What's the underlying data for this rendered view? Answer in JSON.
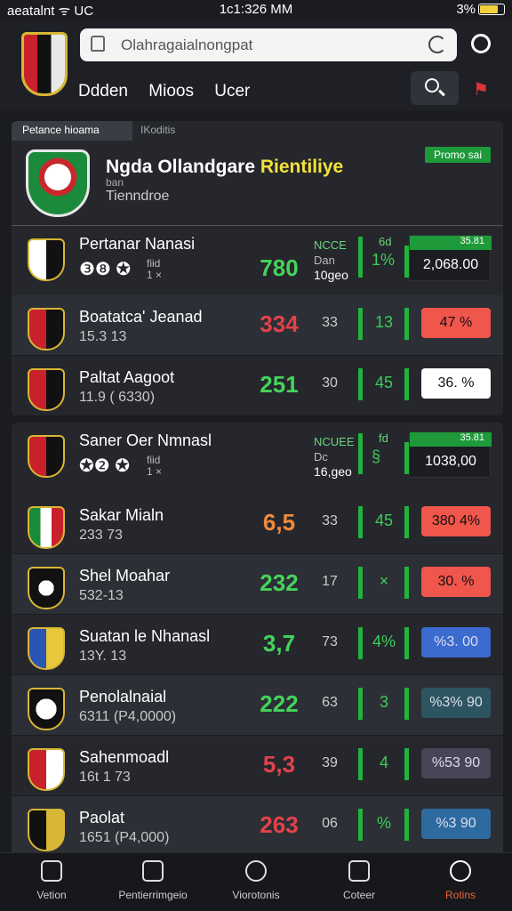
{
  "status": {
    "left": "aeatalnt ᯤ UC",
    "time": "1c1:326 MM",
    "right": "3%"
  },
  "search": {
    "placeholder": "Olahragaialnongpat"
  },
  "nav": {
    "items": [
      "Ddden",
      "Mioos",
      "Ucer"
    ]
  },
  "panel1": {
    "tabs": [
      "Petance hioama",
      "IKoditis"
    ],
    "league": {
      "name": "Ngda Ollandgare ",
      "highlight": "Rientiliye",
      "small": "ban",
      "sub": "Tienndroe",
      "promo": "Promo sai"
    },
    "top": {
      "team": "Pertanar Nanasi",
      "icons": "❸❽ ✪",
      "note": "fiid\n1 ×",
      "big": "780",
      "colhead": "NCCE",
      "colsub": "Dan",
      "colval": "10geo",
      "small": "1%",
      "smallh": "6d",
      "box_head": "35.81",
      "box_value": "2,068.00"
    },
    "rows": [
      {
        "team": "Boatatca' Jeanad",
        "meta": "15.3 13",
        "big": "334",
        "big_color": "#e2424a",
        "mid": "33",
        "small": "13",
        "pill": "47 %",
        "pill_color": "#f0564b"
      },
      {
        "team": "Paltat Aagoot",
        "meta": "11.9 ( 6330)",
        "big": "251",
        "big_color": "#45d35a",
        "mid": "30",
        "small": "45",
        "pill": "36. %",
        "pill_color": "#ffffff"
      }
    ]
  },
  "panel2": {
    "top": {
      "team": "Saner Oer Nmnasl",
      "icons": "✪❷ ✪",
      "note": "fiid\n1 ×",
      "big": "",
      "colhead": "NCUEE",
      "colsub": "Dc",
      "colval": "16,geo",
      "small": "§",
      "smallh": "fd",
      "box_head": "35.81",
      "box_value": "1038,00"
    },
    "rows": [
      {
        "team": "Sakar Mialn",
        "meta": "233 73",
        "big": "6,5",
        "big_color": "#f08a3b",
        "mid": "33",
        "small": "45",
        "pill": "380 4%",
        "pill_color": "#f0564b"
      },
      {
        "team": "Shel Moahar",
        "meta": "532-13",
        "big": "232",
        "big_color": "#45d35a",
        "mid": "17",
        "small": "×",
        "pill": "30. %",
        "pill_color": "#f0564b"
      },
      {
        "team": "Suatan le Nhanasl",
        "meta": "13Y. 13",
        "big": "3,7",
        "big_color": "#45d35a",
        "mid": "73",
        "small": "4%",
        "pill": "%3. 00",
        "pill_color": "#3c6bd0"
      },
      {
        "team": "Penolalnaial",
        "meta": "6311 (P4,0000)",
        "big": "222",
        "big_color": "#45d35a",
        "mid": "63",
        "small": "3",
        "pill": "%3% 90",
        "pill_color": "#2c5560"
      },
      {
        "team": "Sahenmoadl",
        "meta": "16t 1 73",
        "big": "5,3",
        "big_color": "#e2424a",
        "mid": "39",
        "small": "4",
        "pill": "%53 90",
        "pill_color": "#4a4457"
      },
      {
        "team": "Paolat",
        "meta": "1651 (P4,000)",
        "big": "263",
        "big_color": "#e2424a",
        "mid": "06",
        "small": "%",
        "pill": "%3 90",
        "pill_color": "#2d6aa0"
      }
    ]
  },
  "bottom_nav": [
    {
      "label": "Vetion"
    },
    {
      "label": "Pentierrimgeio"
    },
    {
      "label": "Viorotonis"
    },
    {
      "label": "Coteer"
    },
    {
      "label": "Rotins"
    }
  ]
}
